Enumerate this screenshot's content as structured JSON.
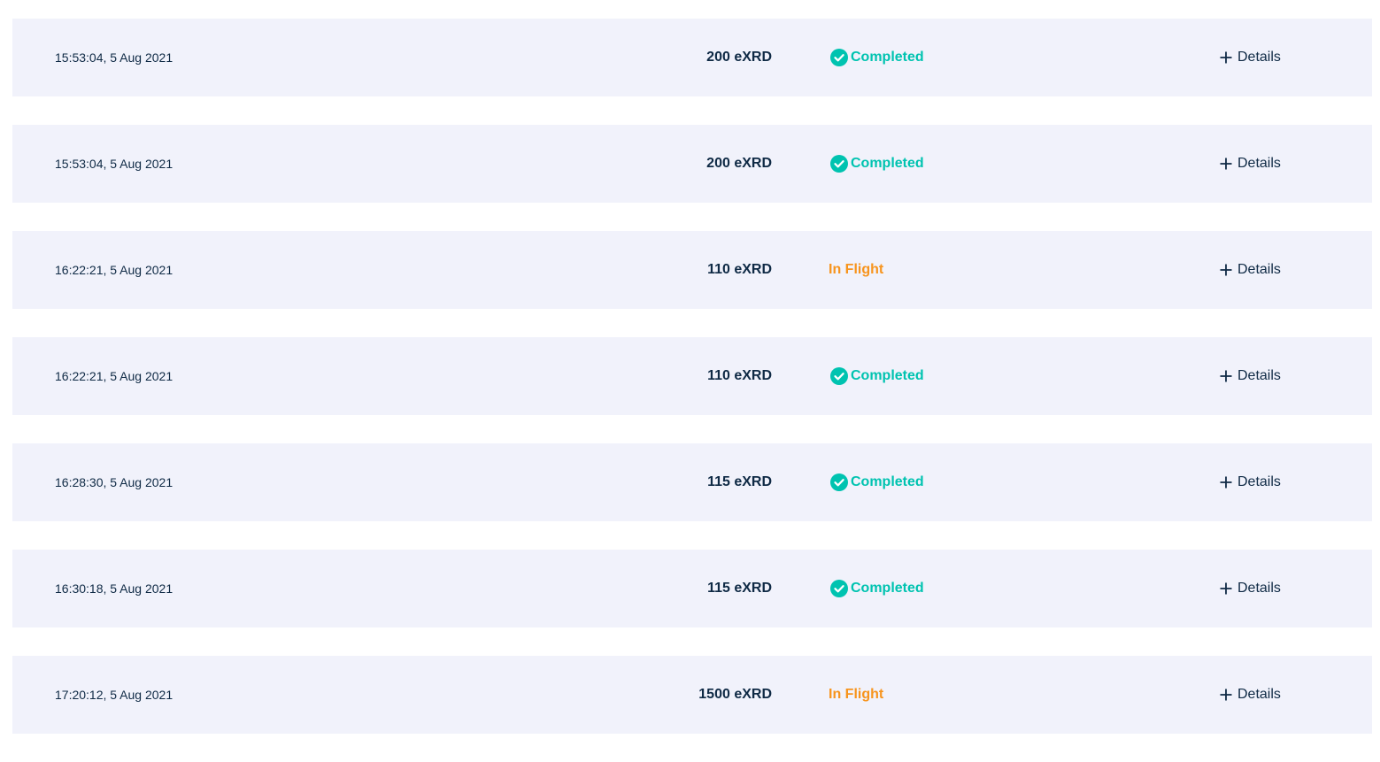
{
  "details_label": "Details",
  "colors": {
    "row_background": "#f1f2fb",
    "text": "#0f2a45",
    "completed": "#00c3b0",
    "in_flight": "#f7941d"
  },
  "transactions": [
    {
      "time": "15:53:04, 5 Aug 2021",
      "amount": "200 eXRD",
      "status": "Completed",
      "status_type": "completed"
    },
    {
      "time": "15:53:04, 5 Aug 2021",
      "amount": "200 eXRD",
      "status": "Completed",
      "status_type": "completed"
    },
    {
      "time": "16:22:21, 5 Aug 2021",
      "amount": "110 eXRD",
      "status": "In Flight",
      "status_type": "inflight"
    },
    {
      "time": "16:22:21, 5 Aug 2021",
      "amount": "110 eXRD",
      "status": "Completed",
      "status_type": "completed"
    },
    {
      "time": "16:28:30, 5 Aug 2021",
      "amount": "115 eXRD",
      "status": "Completed",
      "status_type": "completed"
    },
    {
      "time": "16:30:18, 5 Aug 2021",
      "amount": "115 eXRD",
      "status": "Completed",
      "status_type": "completed"
    },
    {
      "time": "17:20:12, 5 Aug 2021",
      "amount": "1500 eXRD",
      "status": "In Flight",
      "status_type": "inflight"
    }
  ]
}
